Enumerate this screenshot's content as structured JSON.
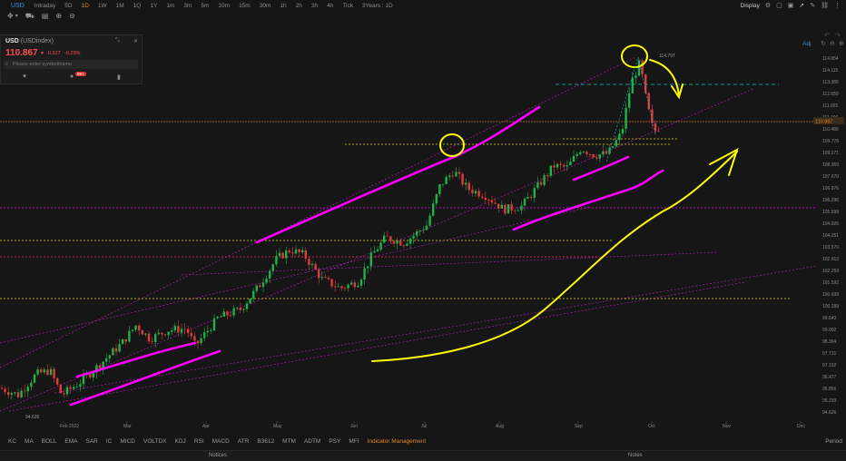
{
  "topbar": {
    "symbol": "USD",
    "timeframes": [
      "Intraday",
      "5D",
      "1D",
      "1W",
      "1M",
      "1Q",
      "1Y",
      "1m",
      "3m",
      "5m",
      "10m",
      "15m",
      "30m",
      "1h",
      "2h",
      "3h",
      "4h",
      "Tick",
      "3Years : 1D"
    ],
    "active_timeframe": "1D",
    "display_label": "Display"
  },
  "quote": {
    "symbol": "USD",
    "name": "(USDindex)",
    "price": "110.867",
    "change": "-0.327",
    "change_pct": "-0.29%",
    "search_placeholder": "Please enter symbol/name",
    "badge": "99+"
  },
  "axis": {
    "adj_label": "Adj",
    "y_ticks": [
      "114.854",
      "114.115",
      "113.389",
      "112.659",
      "111.925",
      "111.196",
      "110.489",
      "109.778",
      "109.071",
      "108.369",
      "107.670",
      "106.976",
      "106.296",
      "105.599",
      "104.926",
      "104.251",
      "103.579",
      "102.913",
      "102.259",
      "101.592",
      "100.939",
      "100.289",
      "99.643",
      "99.002",
      "98.364",
      "97.731",
      "97.102",
      "96.477",
      "95.856",
      "95.239",
      "94.626"
    ],
    "price_tag": "110.867",
    "high_label": "114.797",
    "low_label": "94.626",
    "x_ticks": [
      "Feb 2022",
      "Mar",
      "Apr",
      "May",
      "Jun",
      "Jul",
      "Aug",
      "Sep",
      "Oct",
      "Nov",
      "Dec"
    ]
  },
  "indicators": [
    "KC",
    "MA",
    "BOLL",
    "EMA",
    "SAR",
    "IC",
    "MICD",
    "VOLTDX",
    "KDJ",
    "RSI",
    "MACD",
    "ATR",
    "B3612",
    "MTM",
    "ADTM",
    "PSY",
    "MFI"
  ],
  "indicator_management": "Indicator Management",
  "period_label": "Period",
  "notes": [
    "Notices",
    "Notes"
  ],
  "colors": {
    "up": "#1fb24a",
    "down": "#e23a3a",
    "magenta": "#ff00ff",
    "yellow": "#ffff00",
    "cyan": "#00c8c8",
    "accent": "#e08a2a"
  },
  "icons": [
    "crosshair-icon",
    "settings-icon",
    "undo-icon",
    "redo-icon",
    "cart-icon",
    "layout-icon"
  ]
}
